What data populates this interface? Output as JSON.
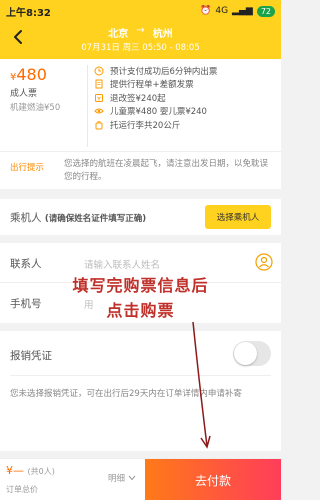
{
  "status_bar": {
    "time": "上午8:32",
    "network": "4G",
    "battery": "72"
  },
  "header": {
    "from": "北京",
    "arrow": "→",
    "to": "杭州",
    "subtitle": "07月31日 周三 05:50 - 08:05"
  },
  "fare": {
    "currency": "¥",
    "price": "480",
    "pax_type": "成人票",
    "fuel": "机建燃油¥50",
    "perks": [
      {
        "icon": "clock-icon",
        "text": "预计支付成功后6分钟内出票"
      },
      {
        "icon": "receipt-icon",
        "text": "提供行程单+差额发票"
      },
      {
        "icon": "refund-icon",
        "text": "退改签¥240起"
      },
      {
        "icon": "eye-icon",
        "text": "儿童票¥480 婴儿票¥240"
      },
      {
        "icon": "luggage-icon",
        "text": "托运行李共20公斤"
      }
    ]
  },
  "notice": {
    "label": "出行提示",
    "text": "您选择的航班在凌晨起飞，请注意出发日期，以免耽误您的行程。"
  },
  "passenger": {
    "title": "乘机人",
    "hint": "(请确保姓名证件填写正确)",
    "choose_button": "选择乘机人"
  },
  "contact": {
    "name_label": "联系人",
    "name_placeholder": "请输入联系人姓名",
    "phone_label": "手机号",
    "phone_placeholder": "用"
  },
  "receipt": {
    "label": "报销凭证",
    "toggle_on": false,
    "note": "您未选择报销凭证，可在出行后29天内在订单详情内申请补寄"
  },
  "annotation": {
    "line1": "填写完购票信息后",
    "line2": "点击购票"
  },
  "bottom_bar": {
    "total": "¥—",
    "count": "(共0人)",
    "total_label": "订单总价",
    "detail": "明细",
    "pay_button": "去付款"
  },
  "colors": {
    "brand_yellow": "#ffd21f",
    "price_orange": "#ff6a00",
    "annotation_red": "#c0302a"
  }
}
